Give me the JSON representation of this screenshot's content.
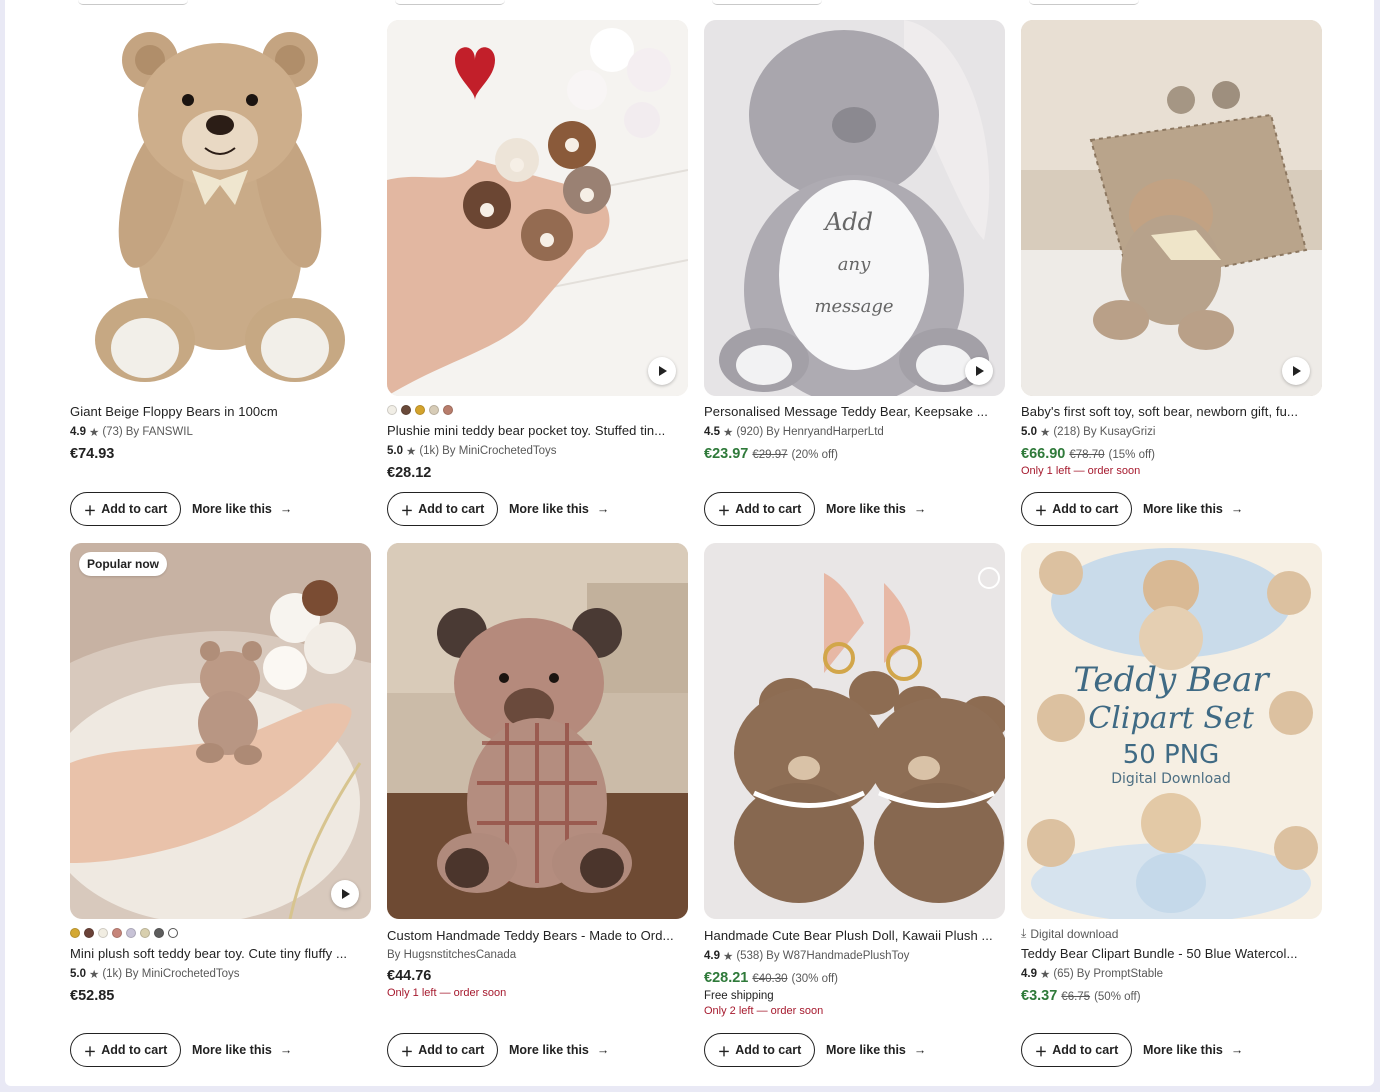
{
  "cards": [
    {
      "title": "Giant Beige Floppy Bears in 100cm",
      "rating": "4.9",
      "reviews": "(73)",
      "shop": "By FANSWIL",
      "price": "€74.93",
      "add_to_cart": "Add to cart",
      "more_like_this": "More like this"
    },
    {
      "swatches": [
        "#f1eee6",
        "#6a4a3a",
        "#d4a32c",
        "#d7ccb7",
        "#b87d6c"
      ],
      "title": "Plushie mini teddy bear pocket toy. Stuffed tin...",
      "rating": "5.0",
      "reviews": "(1k)",
      "shop": "By MiniCrochetedToys",
      "price": "€28.12",
      "add_to_cart": "Add to cart",
      "more_like_this": "More like this"
    },
    {
      "title": "Personalised Message Teddy Bear, Keepsake ...",
      "rating": "4.5",
      "reviews": "(920)",
      "shop": "By HenryandHarperLtd",
      "price": "€23.97",
      "original_price": "€29.97",
      "discount": "(20% off)",
      "image_text": [
        "Add",
        "any",
        "message"
      ],
      "add_to_cart": "Add to cart",
      "more_like_this": "More like this"
    },
    {
      "title": "Baby's first soft toy, soft bear, newborn gift, fu...",
      "rating": "5.0",
      "reviews": "(218)",
      "shop": "By KusayGrizi",
      "price": "€66.90",
      "original_price": "€78.70",
      "discount": "(15% off)",
      "scarcity": "Only 1 left — order soon",
      "add_to_cart": "Add to cart",
      "more_like_this": "More like this"
    },
    {
      "badge": "Popular now",
      "swatches": [
        "#d4a832",
        "#6a4238",
        "#f1ede2",
        "#c6857a",
        "#c7c2d6",
        "#d8cfae",
        "#5d5d5d",
        "#ffffff"
      ],
      "title": "Mini plush soft teddy bear toy. Cute tiny fluffy ...",
      "rating": "5.0",
      "reviews": "(1k)",
      "shop": "By MiniCrochetedToys",
      "price": "€52.85",
      "add_to_cart": "Add to cart",
      "more_like_this": "More like this"
    },
    {
      "title": "Custom Handmade Teddy Bears - Made to Ord...",
      "shop": "By HugsnstitchesCanada",
      "price": "€44.76",
      "scarcity": "Only 1 left — order soon",
      "add_to_cart": "Add to cart",
      "more_like_this": "More like this"
    },
    {
      "title": "Handmade Cute Bear Plush Doll, Kawaii Plush ...",
      "rating": "4.9",
      "reviews": "(538)",
      "shop": "By W87HandmadePlushToy",
      "price": "€28.21",
      "original_price": "€40.30",
      "discount": "(30% off)",
      "shipping": "Free shipping",
      "scarcity": "Only 2 left — order soon",
      "add_to_cart": "Add to cart",
      "more_like_this": "More like this"
    },
    {
      "download_label": "Digital download",
      "title": "Teddy Bear Clipart Bundle - 50 Blue Watercol...",
      "rating": "4.9",
      "reviews": "(65)",
      "shop": "By PromptStable",
      "price": "€3.37",
      "original_price": "€6.75",
      "discount": "(50% off)",
      "image_text": [
        "Teddy Bear",
        "Clipart Set",
        "50 PNG",
        "Digital Download"
      ],
      "add_to_cart": "Add to cart",
      "more_like_this": "More like this"
    }
  ],
  "colors": {
    "sale_price": "#2f7a3a",
    "scarcity": "#a61a2e",
    "text": "#222222",
    "muted": "#595959"
  }
}
